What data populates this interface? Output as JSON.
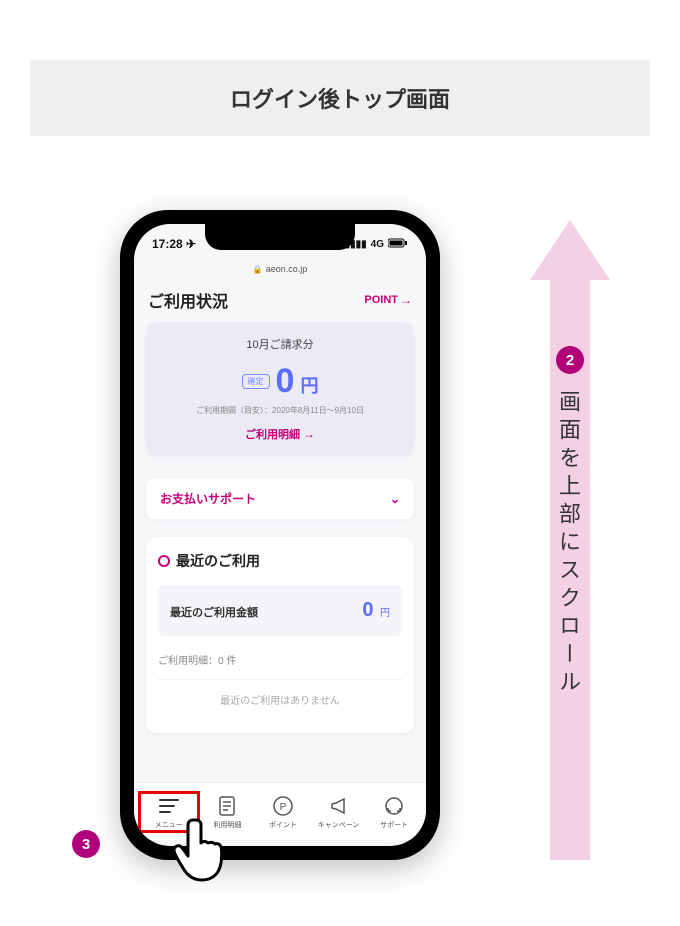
{
  "header": {
    "title": "ログイン後トップ画面"
  },
  "status_bar": {
    "time": "17:28 ✈",
    "signal": "4G"
  },
  "url_bar": {
    "domain": "aeon.co.jp"
  },
  "usage": {
    "title": "ご利用状況",
    "point_link": "POINT",
    "billing_month": "10月ご請求分",
    "confirmed_badge": "確定",
    "amount": "0",
    "yen": "円",
    "period": "ご利用期間（目安）：2020年8月11日〜9月10日",
    "detail_link": "ご利用明細"
  },
  "support": {
    "label": "お支払いサポート"
  },
  "recent": {
    "title": "最近のご利用",
    "amount_label": "最近のご利用金額",
    "amount_value": "0",
    "amount_yen": "円",
    "count": "ご利用明細：0 件",
    "empty": "最近のご利用はありません"
  },
  "nav": {
    "items": [
      {
        "label": "メニュー"
      },
      {
        "label": "利用明細"
      },
      {
        "label": "ポイント"
      },
      {
        "label": "キャンペーン"
      },
      {
        "label": "サポート"
      }
    ]
  },
  "annotation": {
    "scroll_text": "画面を上部にスクロール",
    "step2": "2",
    "step3": "3"
  }
}
